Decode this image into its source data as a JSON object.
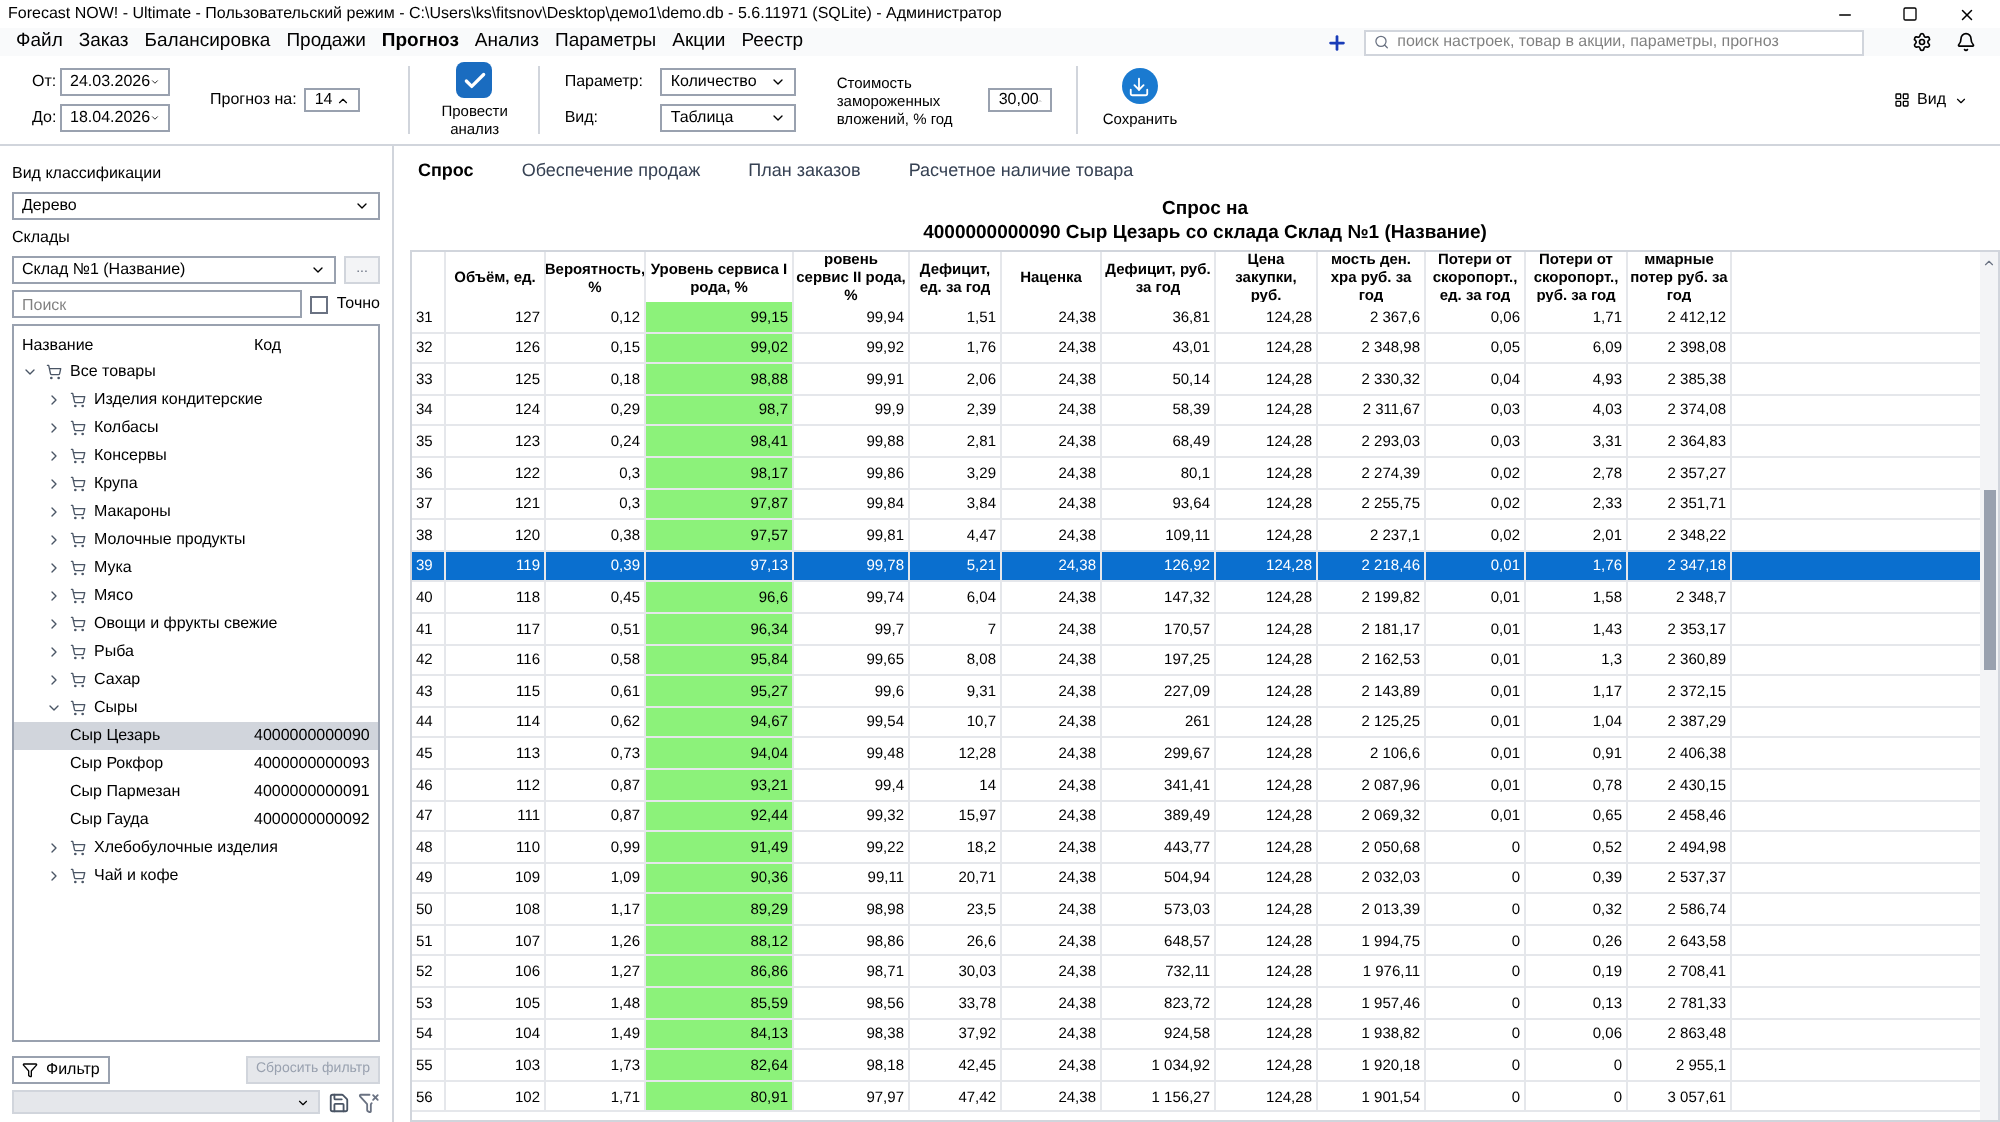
{
  "window": {
    "title": "Forecast NOW! - Ultimate - Пользовательский режим - C:\\Users\\ks\\fitsnov\\Desktop\\демо1\\demo.db - 5.6.11971 (SQLite) - Администратор"
  },
  "menu": [
    {
      "label": "Файл",
      "selected": false
    },
    {
      "label": "Заказ",
      "selected": false
    },
    {
      "label": "Балансировка",
      "selected": false
    },
    {
      "label": "Продажи",
      "selected": false
    },
    {
      "label": "Прогноз",
      "selected": true
    },
    {
      "label": "Анализ",
      "selected": false
    },
    {
      "label": "Параметры",
      "selected": false
    },
    {
      "label": "Акции",
      "selected": false
    },
    {
      "label": "Реестр",
      "selected": false
    }
  ],
  "search": {
    "placeholder": "поиск настроек, товар в акции, параметры, прогноз"
  },
  "toolbar": {
    "from_label": "От:",
    "from": "24.03.2026",
    "to_label": "До:",
    "to": "18.04.2026",
    "forecast_label": "Прогноз на:",
    "forecast": "14",
    "analyze": {
      "label": "Провести анализ",
      "checked": true
    },
    "param_label": "Параметр:",
    "param": "Количество",
    "view_label": "Вид:",
    "view": "Таблица",
    "cost_label": "Стоимость замороженных вложений, % год",
    "cost": "30,00",
    "save": "Сохранить",
    "view_menu": "Вид"
  },
  "left": {
    "class_label": "Вид классификации",
    "class_value": "Дерево",
    "stores_label": "Склады",
    "store_value": "Склад №1 (Название)",
    "more": "...",
    "search_placeholder": "Поиск",
    "exact": {
      "label": "Точно",
      "checked": false
    },
    "col_name": "Название",
    "col_code": "Код",
    "tree": [
      {
        "label": "Все товары",
        "expanded": true,
        "selected": false,
        "children": [
          {
            "label": "Изделия кондитерские",
            "expanded": false,
            "selected": false
          },
          {
            "label": "Колбасы",
            "expanded": false,
            "selected": false
          },
          {
            "label": "Консервы",
            "expanded": false,
            "selected": false
          },
          {
            "label": "Крупа",
            "expanded": false,
            "selected": false
          },
          {
            "label": "Макароны",
            "expanded": false,
            "selected": false
          },
          {
            "label": "Молочные продукты",
            "expanded": false,
            "selected": false
          },
          {
            "label": "Мука",
            "expanded": false,
            "selected": false
          },
          {
            "label": "Мясо",
            "expanded": false,
            "selected": false
          },
          {
            "label": "Овощи и фрукты свежие",
            "expanded": false,
            "selected": false
          },
          {
            "label": "Рыба",
            "expanded": false,
            "selected": false
          },
          {
            "label": "Сахар",
            "expanded": false,
            "selected": false
          },
          {
            "label": "Сыры",
            "expanded": true,
            "selected": false,
            "children": [
              {
                "label": "Сыр Цезарь",
                "code": "4000000000090",
                "selected": true
              },
              {
                "label": "Сыр Рокфор",
                "code": "4000000000093",
                "selected": false
              },
              {
                "label": "Сыр Пармезан",
                "code": "4000000000091",
                "selected": false
              },
              {
                "label": "Сыр Гауда",
                "code": "4000000000092",
                "selected": false
              }
            ]
          },
          {
            "label": "Хлебобулочные изделия",
            "expanded": false,
            "selected": false
          },
          {
            "label": "Чай и кофе",
            "expanded": false,
            "selected": false
          }
        ]
      }
    ],
    "filter": "Фильтр",
    "reset": {
      "label": "Сбросить фильтр",
      "disabled": true
    }
  },
  "tabs": [
    {
      "label": "Спрос",
      "selected": true
    },
    {
      "label": "Обеспечение продаж",
      "selected": false
    },
    {
      "label": "План заказов",
      "selected": false
    },
    {
      "label": "Расчетное наличие товара",
      "selected": false
    }
  ],
  "report_title": [
    "Спрос на",
    "4000000000090 Сыр Цезарь со склада Склад №1 (Название)"
  ],
  "table": {
    "columns": [
      {
        "highlighted": false
      },
      {
        "label": "Объём, ед.",
        "highlighted": false
      },
      {
        "label": "Вероятность, %",
        "highlighted": false
      },
      {
        "label": "Уровень сервиса I рода, %",
        "highlighted": true
      },
      {
        "label": "ровень сервис II рода, %",
        "highlighted": false
      },
      {
        "label": "Дефицит, ед. за год",
        "highlighted": false
      },
      {
        "label": "Наценка",
        "highlighted": false
      },
      {
        "label": "Дефицит, руб. за год",
        "highlighted": false
      },
      {
        "label": "Цена закупки, руб.",
        "highlighted": false
      },
      {
        "label": "мость ден. хра руб. за год",
        "highlighted": false
      },
      {
        "label": "Потери от скоропорт., ед. за год",
        "highlighted": false
      },
      {
        "label": "Потери от скоропорт., руб. за год",
        "highlighted": false
      },
      {
        "label": "ммарные потер руб. за год",
        "highlighted": false
      }
    ],
    "rows": [
      {
        "selected": false,
        "cells": [
          "31",
          "127",
          "0,12",
          "99,15",
          "99,94",
          "1,51",
          "24,38",
          "36,81",
          "124,28",
          "2 367,6",
          "0,06",
          "1,71",
          "2 412,12"
        ]
      },
      {
        "selected": false,
        "cells": [
          "32",
          "126",
          "0,15",
          "99,02",
          "99,92",
          "1,76",
          "24,38",
          "43,01",
          "124,28",
          "2 348,98",
          "0,05",
          "6,09",
          "2 398,08"
        ]
      },
      {
        "selected": false,
        "cells": [
          "33",
          "125",
          "0,18",
          "98,88",
          "99,91",
          "2,06",
          "24,38",
          "50,14",
          "124,28",
          "2 330,32",
          "0,04",
          "4,93",
          "2 385,38"
        ]
      },
      {
        "selected": false,
        "cells": [
          "34",
          "124",
          "0,29",
          "98,7",
          "99,9",
          "2,39",
          "24,38",
          "58,39",
          "124,28",
          "2 311,67",
          "0,03",
          "4,03",
          "2 374,08"
        ]
      },
      {
        "selected": false,
        "cells": [
          "35",
          "123",
          "0,24",
          "98,41",
          "99,88",
          "2,81",
          "24,38",
          "68,49",
          "124,28",
          "2 293,03",
          "0,03",
          "3,31",
          "2 364,83"
        ]
      },
      {
        "selected": false,
        "cells": [
          "36",
          "122",
          "0,3",
          "98,17",
          "99,86",
          "3,29",
          "24,38",
          "80,1",
          "124,28",
          "2 274,39",
          "0,02",
          "2,78",
          "2 357,27"
        ]
      },
      {
        "selected": false,
        "cells": [
          "37",
          "121",
          "0,3",
          "97,87",
          "99,84",
          "3,84",
          "24,38",
          "93,64",
          "124,28",
          "2 255,75",
          "0,02",
          "2,33",
          "2 351,71"
        ]
      },
      {
        "selected": false,
        "cells": [
          "38",
          "120",
          "0,38",
          "97,57",
          "99,81",
          "4,47",
          "24,38",
          "109,11",
          "124,28",
          "2 237,1",
          "0,02",
          "2,01",
          "2 348,22"
        ]
      },
      {
        "selected": true,
        "cells": [
          "39",
          "119",
          "0,39",
          "97,13",
          "99,78",
          "5,21",
          "24,38",
          "126,92",
          "124,28",
          "2 218,46",
          "0,01",
          "1,76",
          "2 347,18"
        ]
      },
      {
        "selected": false,
        "cells": [
          "40",
          "118",
          "0,45",
          "96,6",
          "99,74",
          "6,04",
          "24,38",
          "147,32",
          "124,28",
          "2 199,82",
          "0,01",
          "1,58",
          "2 348,7"
        ]
      },
      {
        "selected": false,
        "cells": [
          "41",
          "117",
          "0,51",
          "96,34",
          "99,7",
          "7",
          "24,38",
          "170,57",
          "124,28",
          "2 181,17",
          "0,01",
          "1,43",
          "2 353,17"
        ]
      },
      {
        "selected": false,
        "cells": [
          "42",
          "116",
          "0,58",
          "95,84",
          "99,65",
          "8,08",
          "24,38",
          "197,25",
          "124,28",
          "2 162,53",
          "0,01",
          "1,3",
          "2 360,89"
        ]
      },
      {
        "selected": false,
        "cells": [
          "43",
          "115",
          "0,61",
          "95,27",
          "99,6",
          "9,31",
          "24,38",
          "227,09",
          "124,28",
          "2 143,89",
          "0,01",
          "1,17",
          "2 372,15"
        ]
      },
      {
        "selected": false,
        "cells": [
          "44",
          "114",
          "0,62",
          "94,67",
          "99,54",
          "10,7",
          "24,38",
          "261",
          "124,28",
          "2 125,25",
          "0,01",
          "1,04",
          "2 387,29"
        ]
      },
      {
        "selected": false,
        "cells": [
          "45",
          "113",
          "0,73",
          "94,04",
          "99,48",
          "12,28",
          "24,38",
          "299,67",
          "124,28",
          "2 106,6",
          "0,01",
          "0,91",
          "2 406,38"
        ]
      },
      {
        "selected": false,
        "cells": [
          "46",
          "112",
          "0,87",
          "93,21",
          "99,4",
          "14",
          "24,38",
          "341,41",
          "124,28",
          "2 087,96",
          "0,01",
          "0,78",
          "2 430,15"
        ]
      },
      {
        "selected": false,
        "cells": [
          "47",
          "111",
          "0,87",
          "92,44",
          "99,32",
          "15,97",
          "24,38",
          "389,49",
          "124,28",
          "2 069,32",
          "0,01",
          "0,65",
          "2 458,46"
        ]
      },
      {
        "selected": false,
        "cells": [
          "48",
          "110",
          "0,99",
          "91,49",
          "99,22",
          "18,2",
          "24,38",
          "443,77",
          "124,28",
          "2 050,68",
          "0",
          "0,52",
          "2 494,98"
        ]
      },
      {
        "selected": false,
        "cells": [
          "49",
          "109",
          "1,09",
          "90,36",
          "99,11",
          "20,71",
          "24,38",
          "504,94",
          "124,28",
          "2 032,03",
          "0",
          "0,39",
          "2 537,37"
        ]
      },
      {
        "selected": false,
        "cells": [
          "50",
          "108",
          "1,17",
          "89,29",
          "98,98",
          "23,5",
          "24,38",
          "573,03",
          "124,28",
          "2 013,39",
          "0",
          "0,32",
          "2 586,74"
        ]
      },
      {
        "selected": false,
        "cells": [
          "51",
          "107",
          "1,26",
          "88,12",
          "98,86",
          "26,6",
          "24,38",
          "648,57",
          "124,28",
          "1 994,75",
          "0",
          "0,26",
          "2 643,58"
        ]
      },
      {
        "selected": false,
        "cells": [
          "52",
          "106",
          "1,27",
          "86,86",
          "98,71",
          "30,03",
          "24,38",
          "732,11",
          "124,28",
          "1 976,11",
          "0",
          "0,19",
          "2 708,41"
        ]
      },
      {
        "selected": false,
        "cells": [
          "53",
          "105",
          "1,48",
          "85,59",
          "98,56",
          "33,78",
          "24,38",
          "823,72",
          "124,28",
          "1 957,46",
          "0",
          "0,13",
          "2 781,33"
        ]
      },
      {
        "selected": false,
        "cells": [
          "54",
          "104",
          "1,49",
          "84,13",
          "98,38",
          "37,92",
          "24,38",
          "924,58",
          "124,28",
          "1 938,82",
          "0",
          "0,06",
          "2 863,48"
        ]
      },
      {
        "selected": false,
        "cells": [
          "55",
          "103",
          "1,73",
          "82,64",
          "98,18",
          "42,45",
          "24,38",
          "1 034,92",
          "124,28",
          "1 920,18",
          "0",
          "0",
          "2 955,1"
        ]
      },
      {
        "selected": false,
        "cells": [
          "56",
          "102",
          "1,71",
          "80,91",
          "97,97",
          "47,42",
          "24,38",
          "1 156,27",
          "124,28",
          "1 901,54",
          "0",
          "0",
          "3 057,61"
        ]
      }
    ]
  }
}
